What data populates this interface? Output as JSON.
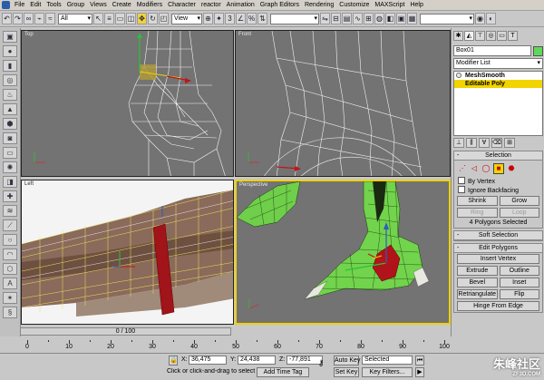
{
  "menu": {
    "items": [
      "File",
      "Edit",
      "Tools",
      "Group",
      "Views",
      "Create",
      "Modifiers",
      "Character",
      "reactor",
      "Animation",
      "Graph Editors",
      "Rendering",
      "Customize",
      "MAXScript",
      "Help"
    ]
  },
  "toolbar": {
    "filter": "All",
    "coord": "View"
  },
  "viewports": {
    "top": {
      "label": "Top"
    },
    "front": {
      "label": "Front"
    },
    "left": {
      "label": "Left"
    },
    "perspective": {
      "label": "Perspective"
    }
  },
  "command_panel": {
    "object_name": "Box01",
    "modifier_list": "Modifier List",
    "stack": [
      {
        "label": "MeshSmooth",
        "selected": false
      },
      {
        "label": "Editable Poly",
        "selected": true
      }
    ],
    "selection_rollout": "Selection",
    "by_vertex": "By Vertex",
    "ignore_backfacing": "Ignore Backfacing",
    "shrink": "Shrink",
    "grow": "Grow",
    "ring": "Ring",
    "loop": "Loop",
    "selected_text": "4 Polygons Selected",
    "soft_selection_rollout": "Soft Selection",
    "edit_polygons_rollout": "Edit Polygons",
    "insert_vertex": "Insert Vertex",
    "extrude": "Extrude",
    "outline": "Outline",
    "bevel": "Bevel",
    "inset": "Inset",
    "retriangulate": "Retriangulate",
    "flip": "Flip",
    "hinge_from_edge": "Hinge From Edge"
  },
  "timeline": {
    "slider": "0 / 100",
    "ticks": [
      "0",
      "10",
      "20",
      "30",
      "40",
      "50",
      "60",
      "70",
      "80",
      "90",
      "100"
    ]
  },
  "status": {
    "x_label": "X:",
    "x": "36,475",
    "y_label": "Y:",
    "y": "24,438",
    "z_label": "Z:",
    "z": "-77,891",
    "auto_key": "Auto Key",
    "set_key": "Set Key",
    "selected": "Selected",
    "key_filters": "Key Filters...",
    "prompt": "Click or click-and-drag to select obj",
    "add_time_tag": "Add Time Tag"
  },
  "watermark": {
    "text": "朱峰社区",
    "sub": "ZF3D.COM"
  },
  "colors": {
    "viewport_bg": "#737373",
    "active_border": "#f2d000",
    "selection_yellow": "#f2d400",
    "mesh_green": "#7ed957",
    "poly_red": "#c0141a"
  }
}
